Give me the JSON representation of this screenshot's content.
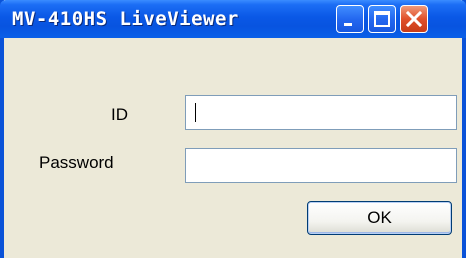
{
  "window": {
    "title": "MV-410HS LiveViewer"
  },
  "titlebar_buttons": {
    "minimize": "minimize",
    "maximize": "maximize",
    "close": "close"
  },
  "form": {
    "id_label": "ID",
    "id_value": "",
    "password_label": "Password",
    "password_value": "",
    "ok_label": "OK"
  },
  "colors": {
    "titlebar": "#0a58e6",
    "window_body": "#ece9d8",
    "close_button": "#e0502a"
  }
}
